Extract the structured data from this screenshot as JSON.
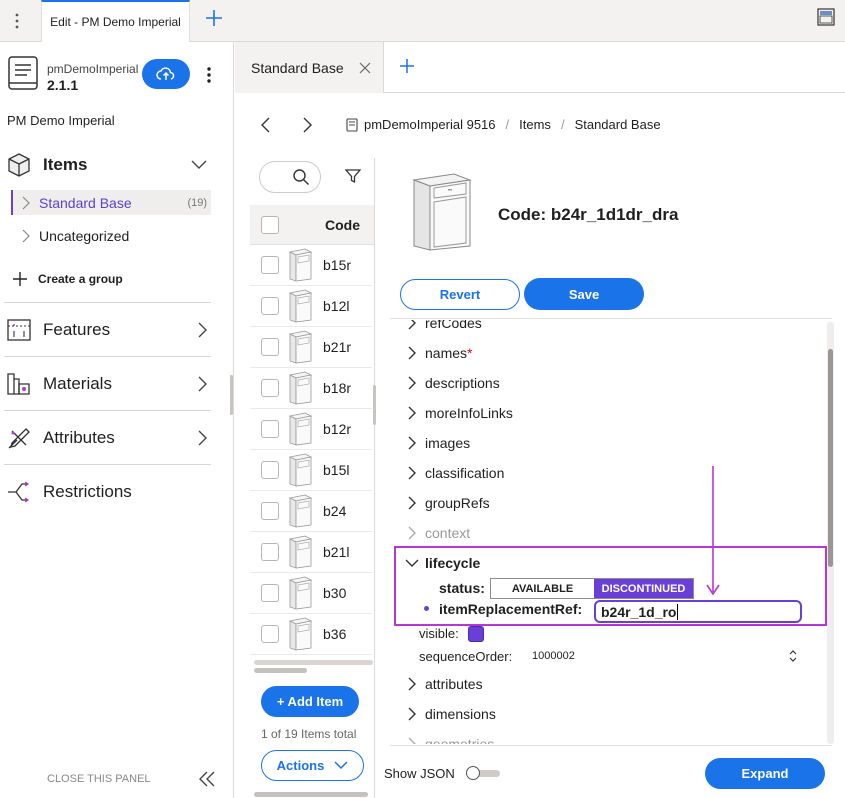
{
  "topbar": {
    "tab_label": "Edit - PM Demo Imperial"
  },
  "sidebar": {
    "project_name": "pmDemoImperial",
    "version": "2.1.1",
    "title": "PM Demo Imperial",
    "items_label": "Items",
    "groups": [
      {
        "label": "Standard Base",
        "count": "(19)"
      },
      {
        "label": "Uncategorized"
      }
    ],
    "create_group": "Create a group",
    "nav": [
      {
        "label": "Features"
      },
      {
        "label": "Materials"
      },
      {
        "label": "Attributes"
      },
      {
        "label": "Restrictions"
      }
    ],
    "close_panel": "CLOSE THIS PANEL"
  },
  "tabs": {
    "active": "Standard Base"
  },
  "breadcrumb": {
    "project": "pmDemoImperial 9516",
    "items": "Items",
    "group": "Standard Base"
  },
  "list": {
    "column_header": "Code",
    "codes": [
      "b15r",
      "b12l",
      "b21r",
      "b18r",
      "b12r",
      "b15l",
      "b24",
      "b21l",
      "b30",
      "b36"
    ],
    "add_item": "+ Add Item",
    "count_text": "1 of 19 Items total",
    "actions": "Actions"
  },
  "detail": {
    "code_label": "Code: b24r_1d1dr_dra",
    "revert": "Revert",
    "save": "Save",
    "tree": {
      "refcodes": "refCodes",
      "names": "names",
      "required_mark": "*",
      "descriptions": "descriptions",
      "moreinfo": "moreInfoLinks",
      "images": "images",
      "classification": "classification",
      "grouprefs": "groupRefs",
      "context": "context",
      "lifecycle": "lifecycle",
      "status_label": "status:",
      "status_available": "AVAILABLE",
      "status_discontinued": "DISCONTINUED",
      "replacement_label": "itemReplacementRef:",
      "replacement_value": "b24r_1d_ro",
      "visible_label": "visible:",
      "sequence_label": "sequenceOrder:",
      "sequence_value": "1000002",
      "attributes": "attributes",
      "dimensions": "dimensions",
      "geometries": "geometries"
    },
    "show_json": "Show JSON",
    "expand": "Expand"
  },
  "colors": {
    "accent": "#1a73e8",
    "highlight": "#b636d8",
    "discontinued": "#6a3fd8"
  }
}
